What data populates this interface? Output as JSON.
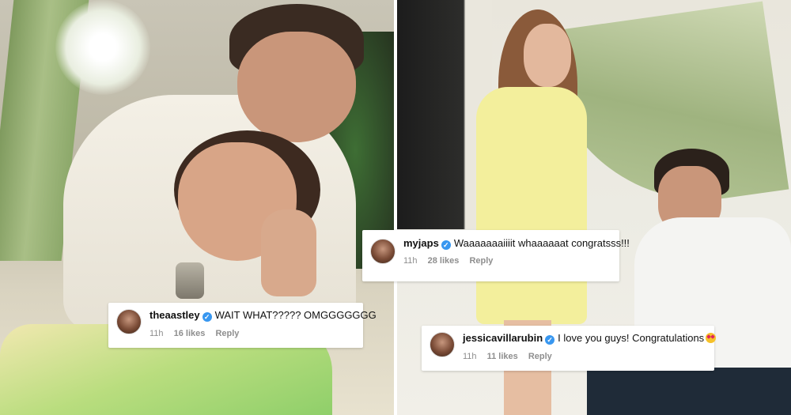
{
  "comments": [
    {
      "username": "myjaps",
      "text": "Waaaaaaaiiiit whaaaaaat congratsss!!!",
      "time": "11h",
      "likes": "28 likes",
      "reply": "Reply",
      "verified": true
    },
    {
      "username": "theaastley",
      "text": "WAIT WHAT????? OMGGGGGGG",
      "time": "11h",
      "likes": "16 likes",
      "reply": "Reply",
      "verified": true
    },
    {
      "username": "jessicavillarubin",
      "text": "I love you guys! Congratulations",
      "time": "11h",
      "likes": "11 likes",
      "reply": "Reply",
      "verified": true,
      "emoji": "heart-eyes-emoji"
    }
  ],
  "colors": {
    "verified_badge": "#3897f0",
    "meta_text": "#8e8e8e",
    "drape_green": "#9fb37f",
    "dress_yellow": "#f3ef9c"
  }
}
